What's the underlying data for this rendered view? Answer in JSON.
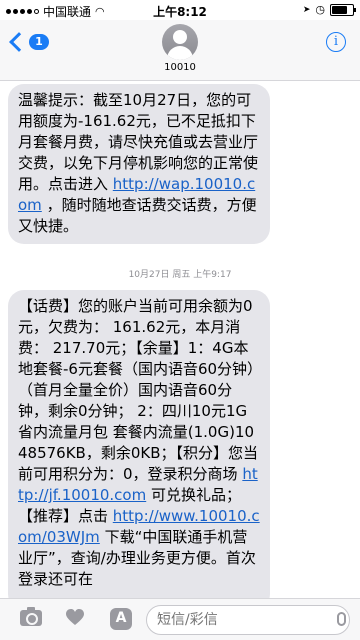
{
  "status_bar": {
    "carrier": "中国联通",
    "time": "上午8:12",
    "battery_level": 0.85
  },
  "header": {
    "back_badge": "1",
    "contact_name": "10010",
    "info_label": "i"
  },
  "messages": [
    {
      "text_before": "温馨提示：截至10月27日，您的可用额度为-161.62元，已不足抵扣下月套餐月费，请尽快充值或去营业厅交费，以免下月停机影响您的正常使用。点击进入 ",
      "link": "http://wap.10010.com",
      "text_after": " ，随时随地查话费交话费，方便又快捷。"
    }
  ],
  "timestamp": "10月27日 周五 上午9:17",
  "message2": {
    "p1": "【话费】您的账户当前可用余额为0元，欠费为： 161.62元，本月消费： 217.70元；【余量】1：4G本地套餐-6元套餐（国内语音60分钟）（首月全量全价）国内语音60分钟，剩余0分钟； 2：四川10元1G省内流量月包 套餐内流量(1.0G)1048576KB，剩余0KB；【积分】您当前可用积分为：0，登录积分商场 ",
    "link1": "http://jf.10010.com",
    "p2": " 可兑换礼品；【推荐】点击 ",
    "link2": "http://www.10010.com/03WJm",
    "p3": " 下载“中国联通手机营业厅”，查询/办理业务更方便。首次登录还可在"
  },
  "input_bar": {
    "placeholder": "短信/彩信"
  }
}
